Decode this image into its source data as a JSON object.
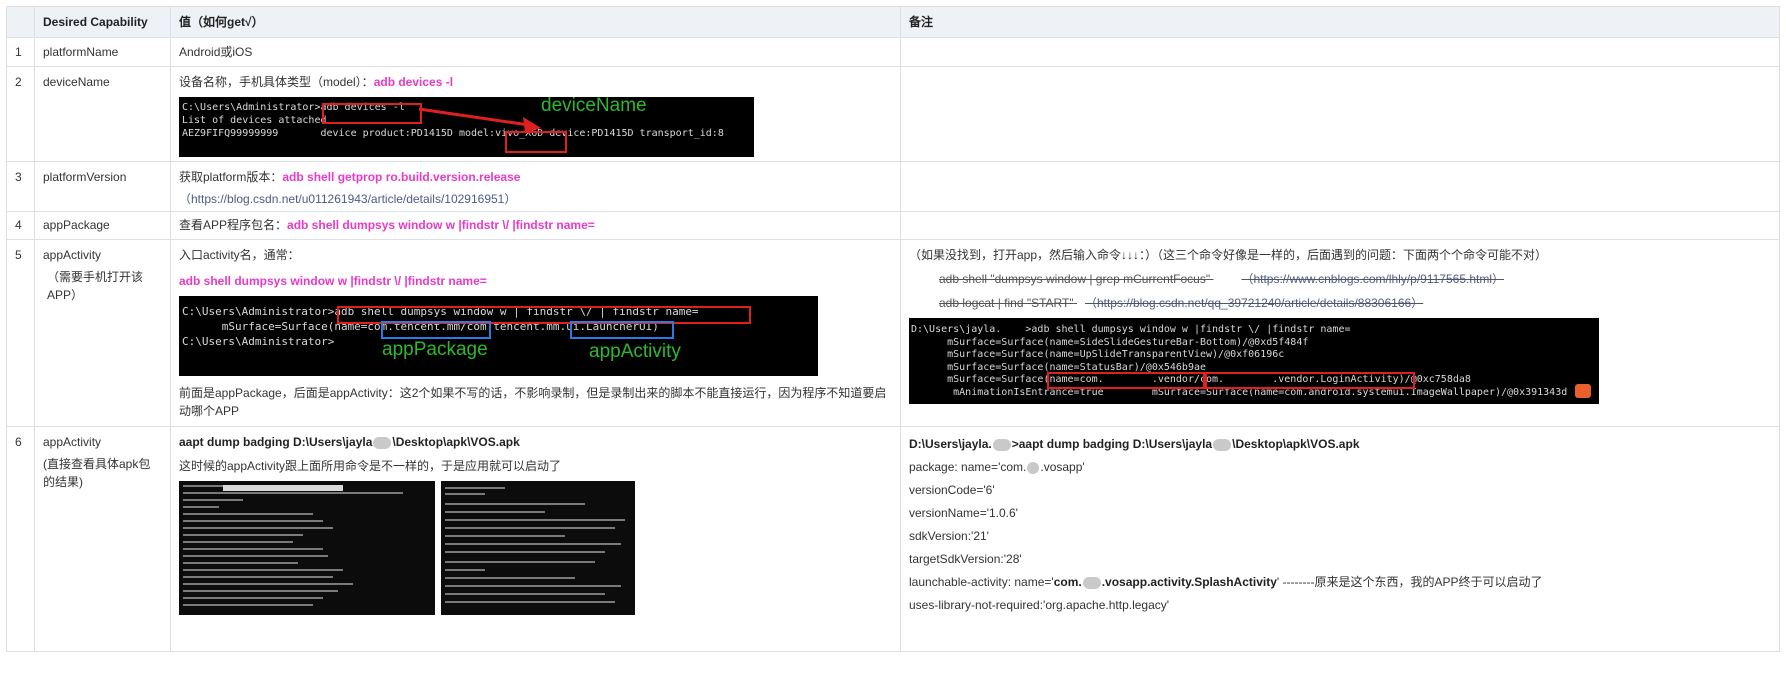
{
  "headers": [
    "",
    "Desired Capability",
    "值（如何get√）",
    "备注"
  ],
  "rows": [
    {
      "idx": "1",
      "cap": "platformName",
      "val": "Android或iOS"
    },
    {
      "idx": "2",
      "cap": "deviceName",
      "val_prefix": "设备名称，手机具体类型（model）：",
      "val_cmd": "adb devices -l",
      "terminal": {
        "lines": [
          "C:\\Users\\Administrator>adb devices -l",
          "List of devices attached",
          "AEZ9FIFQ99999999       device product:PD1415D model:vivo_X6D device:PD1415D transport_id:8"
        ],
        "annotation": "deviceName"
      }
    },
    {
      "idx": "3",
      "cap": "platformVersion",
      "val_prefix": "获取platform版本：",
      "val_cmd": "adb shell getprop ro.build.version.release",
      "val_link": "（https://blog.csdn.net/u011261943/article/details/102916951）"
    },
    {
      "idx": "4",
      "cap": "appPackage",
      "val_prefix": "查看APP程序包名：",
      "val_cmd": "adb shell dumpsys window w |findstr \\/ |findstr name="
    },
    {
      "idx": "5",
      "cap": "appActivity",
      "cap_note": "（需要手机打开该APP）",
      "val_intro": "入口activity名，通常：",
      "val_cmd": "adb shell dumpsys window w |findstr \\/ |findstr name=",
      "terminal": {
        "lines": [
          "C:\\Users\\Administrator>adb shell dumpsys window w | findstr \\/ | findstr name=",
          "      mSurface=Surface(name=com.tencent.mm/com.tencent.mm.ui.LauncherUI)",
          "",
          "C:\\Users\\Administrator>"
        ],
        "label_pkg": "appPackage",
        "label_act": "appActivity"
      },
      "val_note": "前面是appPackage，后面是appActivity：这2个如果不写的话，不影响录制，但是录制出来的脚本不能直接运行，因为程序不知道要启动哪个APP",
      "remark_intro": "（如果没找到，打开app，然后输入命令↓↓↓：）（这三个命令好像是一样的，后面遇到的问题：下面两个个命令可能不对）",
      "remark_strike1_cmd": "adb shell \"dumpsys window | grep mCurrentFocus\"",
      "remark_strike1_link": "（https://www.cnblogs.com/lhly/p/9117565.html）",
      "remark_strike2_cmd": "adb logcat | find \"START\"",
      "remark_strike2_link": "（https://blog.csdn.net/qq_39721240/article/details/88306166）",
      "remark_terminal": {
        "lines": [
          "D:\\Users\\jayla.    >adb shell dumpsys window w |findstr \\/ |findstr name=",
          "      mSurface=Surface(name=SideSlideGestureBar-Bottom)/@0xd5f484f",
          "      mSurface=Surface(name=UpSlideTransparentView)/@0xf06196c",
          "      mSurface=Surface(name=StatusBar)/@0x546b9ae",
          "      mSurface=Surface(name=com.        .vendor/com.        .vendor.LoginActivity)/@0xc758da8",
          "       mAnimationIsEntrance=true        mSurface=Surface(name=com.android.systemui.ImageWallpaper)/@0x391343d"
        ]
      }
    },
    {
      "idx": "6",
      "cap": "appActivity",
      "cap_note": "(直接查看具体apk包的结果)",
      "val_cmd_a": "aapt dump badging D:\\Users\\jayla",
      "val_cmd_b": "\\Desktop\\apk\\VOS.apk",
      "val_note": "这时候的appActivity跟上面所用命令是不一样的，于是应用就可以启动了",
      "remark_cmd_a": "D:\\Users\\jayla.",
      "remark_cmd_b": ">aapt dump badging D:\\Users\\jayla",
      "remark_cmd_c": "\\Desktop\\apk\\VOS.apk",
      "remark_package_a": "package: name='com.",
      "remark_package_b": ".vosapp'",
      "remark_versionCode": "versionCode='6'",
      "remark_versionName": "versionName='1.0.6'",
      "remark_sdk": "sdkVersion:'21'",
      "remark_target": "targetSdkVersion:'28'",
      "remark_launch_a": "launchable-activity: name='",
      "remark_launch_b": "com.",
      "remark_launch_c": ".vosapp.activity.SplashActivity",
      "remark_launch_d": "'   --------原来是这个东西，我的APP终于可以启动了",
      "remark_uses": "uses-library-not-required:'org.apache.http.legacy'"
    }
  ]
}
